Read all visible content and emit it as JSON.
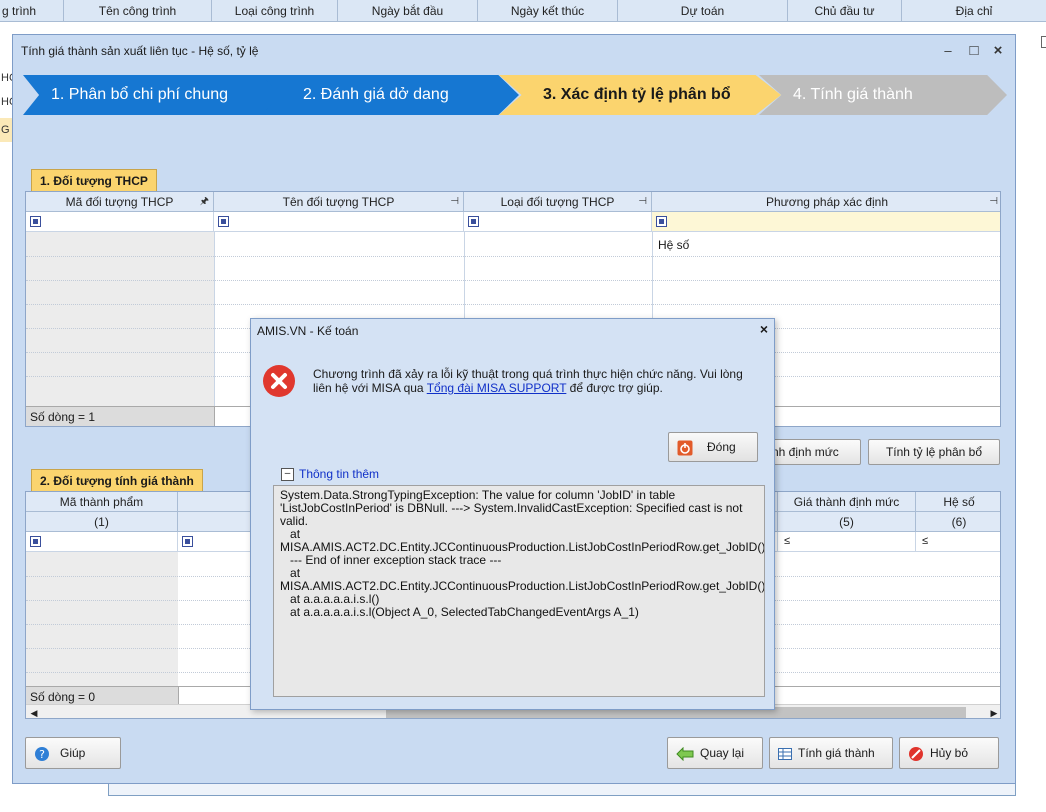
{
  "background": {
    "columns": [
      "g trình",
      "Tên công trình",
      "Loại công trình",
      "Ngày bắt đầu",
      "Ngày kết thúc",
      "Dự toán",
      "Chủ đầu tư",
      "Địa chỉ"
    ],
    "row_prefixes": [
      "HC",
      "HC",
      "G"
    ]
  },
  "window": {
    "title": "Tính giá thành sản xuất liên tục - Hệ số, tỷ lệ",
    "minimize": "–",
    "maximize": "□",
    "close": "×"
  },
  "steps": [
    {
      "label": "1. Phân bổ chi phí chung",
      "state": "done"
    },
    {
      "label": "2. Đánh giá dở dang",
      "state": "done"
    },
    {
      "label": "3. Xác định tỷ lệ phân bổ",
      "state": "active"
    },
    {
      "label": "4. Tính giá thành",
      "state": "pending"
    }
  ],
  "section1": {
    "tab": "1. Đối tượng THCP",
    "columns": [
      "Mã đối tượng THCP",
      "Tên đối tượng THCP",
      "Loại đối tượng THCP",
      "Phương pháp xác định"
    ],
    "rows": [
      {
        "method": "Hệ số"
      }
    ],
    "footer": "Số dòng = 1"
  },
  "section2": {
    "tab": "2. Đối tượng tính giá thành",
    "columns": [
      "Mã thành phẩm",
      "Giá thành định mức",
      "Hệ số"
    ],
    "column_numbers": [
      "(1)",
      "(5)",
      "(6)"
    ],
    "footer": "Số dòng = 0",
    "filter_symbol": "≤"
  },
  "buttons": {
    "calc_norm_partial": "nh định mức",
    "calc_ratio": "Tính tỷ lệ phân bổ",
    "help": "Giúp",
    "back": "Quay lại",
    "calc_cost": "Tính giá thành",
    "cancel": "Hủy bỏ"
  },
  "dialog": {
    "title": "AMIS.VN - Kế toán",
    "close_x": "×",
    "message_before_link": "Chương trình đã xảy ra lỗi kỹ thuật trong quá trình thực hiện chức năng. Vui lòng liên hệ với MISA qua ",
    "link": "Tổng đài MISA SUPPORT",
    "message_after_link": " để được trợ giúp.",
    "close_button": "Đóng",
    "more_toggle": "–",
    "more_label": "Thông tin thêm",
    "trace": "System.Data.StrongTypingException: The value for column 'JobID' in table 'ListJobCostInPeriod' is DBNull. ---> System.InvalidCastException: Specified cast is not valid.\n   at\nMISA.AMIS.ACT2.DC.Entity.JCContinuousProduction.ListJobCostInPeriodRow.get_JobID()\n   --- End of inner exception stack trace ---\n   at\nMISA.AMIS.ACT2.DC.Entity.JCContinuousProduction.ListJobCostInPeriodRow.get_JobID()\n   at a.a.a.a.a.i.s.l()\n   at a.a.a.a.a.i.s.l(Object A_0, SelectedTabChangedEventArgs A_1)"
  }
}
